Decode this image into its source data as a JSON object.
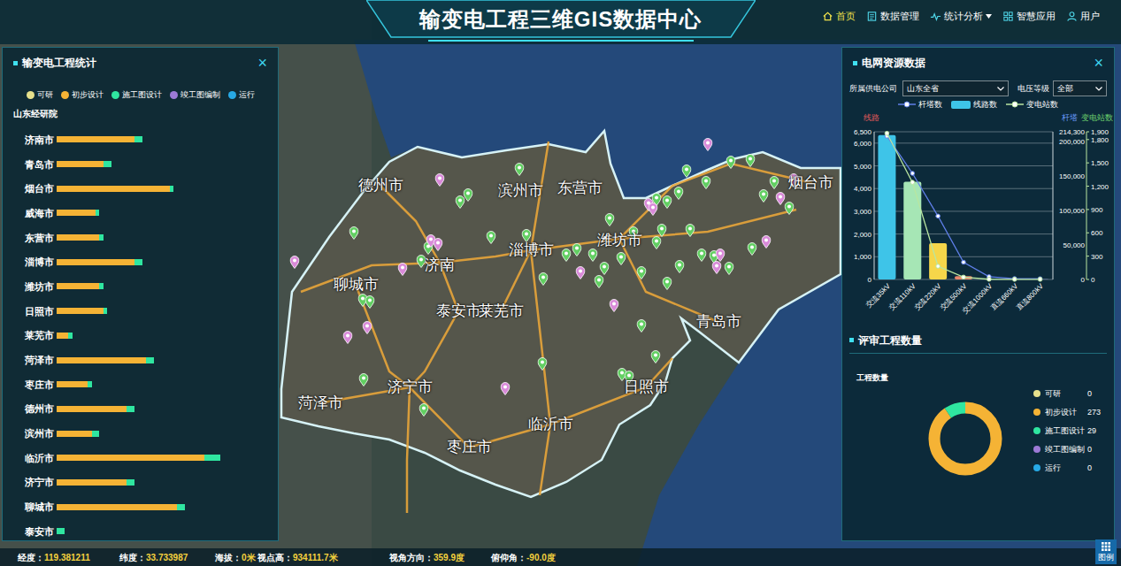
{
  "header": {
    "title": "输变电工程三维GIS数据中心",
    "nav": [
      {
        "label": "首页",
        "kind": "home",
        "selected": true,
        "has_menu": false
      },
      {
        "label": "数据管理",
        "kind": "data",
        "selected": false,
        "has_menu": false
      },
      {
        "label": "统计分析",
        "kind": "stats",
        "selected": false,
        "has_menu": true
      },
      {
        "label": "智慧应用",
        "kind": "apps",
        "selected": false,
        "has_menu": false
      },
      {
        "label": "用户",
        "kind": "user",
        "selected": false,
        "has_menu": false
      }
    ]
  },
  "map": {
    "labels": [
      "德州市",
      "滨州市",
      "东营市",
      "烟台市",
      "淄博市",
      "潍坊市",
      "济南",
      "聊城市",
      "泰安市",
      "莱芜市",
      "青岛市",
      "济宁市",
      "日照市",
      "菏泽市",
      "临沂市",
      "枣庄市"
    ],
    "markers": [
      {
        "color": "#62cf62"
      },
      {
        "color": "#62cf62"
      },
      {
        "color": "#62cf62"
      },
      {
        "color": "#62cf62"
      },
      {
        "color": "#62cf62"
      },
      {
        "color": "#62cf62"
      },
      {
        "color": "#62cf62"
      },
      {
        "color": "#62cf62"
      },
      {
        "color": "#62cf62"
      },
      {
        "color": "#62cf62"
      },
      {
        "color": "#62cf62"
      },
      {
        "color": "#62cf62"
      },
      {
        "color": "#62cf62"
      },
      {
        "color": "#62cf62"
      },
      {
        "color": "#62cf62"
      },
      {
        "color": "#62cf62"
      },
      {
        "color": "#62cf62"
      },
      {
        "color": "#62cf62"
      },
      {
        "color": "#62cf62"
      },
      {
        "color": "#62cf62"
      },
      {
        "color": "#62cf62"
      },
      {
        "color": "#62cf62"
      },
      {
        "color": "#62cf62"
      },
      {
        "color": "#62cf62"
      },
      {
        "color": "#62cf62"
      },
      {
        "color": "#62cf62"
      },
      {
        "color": "#62cf62"
      },
      {
        "color": "#62cf62"
      },
      {
        "color": "#62cf62"
      },
      {
        "color": "#62cf62"
      },
      {
        "color": "#62cf62"
      },
      {
        "color": "#62cf62"
      },
      {
        "color": "#62cf62"
      },
      {
        "color": "#62cf62"
      },
      {
        "color": "#62cf62"
      },
      {
        "color": "#62cf62"
      },
      {
        "color": "#62cf62"
      },
      {
        "color": "#62cf62"
      },
      {
        "color": "#62cf62"
      },
      {
        "color": "#62cf62"
      },
      {
        "color": "#62cf62"
      },
      {
        "color": "#62cf62"
      },
      {
        "color": "#62cf62"
      },
      {
        "color": "#62cf62"
      },
      {
        "color": "#62cf62"
      },
      {
        "color": "#62cf62"
      },
      {
        "color": "#d98ad9"
      },
      {
        "color": "#d98ad9"
      },
      {
        "color": "#d98ad9"
      },
      {
        "color": "#d98ad9"
      },
      {
        "color": "#d98ad9"
      },
      {
        "color": "#d98ad9"
      },
      {
        "color": "#d98ad9"
      },
      {
        "color": "#d98ad9"
      },
      {
        "color": "#d98ad9"
      },
      {
        "color": "#d98ad9"
      },
      {
        "color": "#d98ad9"
      },
      {
        "color": "#d98ad9"
      },
      {
        "color": "#d98ad9"
      },
      {
        "color": "#d98ad9"
      },
      {
        "color": "#d98ad9"
      },
      {
        "color": "#d98ad9"
      },
      {
        "color": "#d98ad9"
      },
      {
        "color": "#d98ad9"
      }
    ]
  },
  "left_panel": {
    "title": "输变电工程统计",
    "close": "×",
    "legend": [
      {
        "label": "可研",
        "color": "#e6e08c"
      },
      {
        "label": "初步设计",
        "color": "#f5b335"
      },
      {
        "label": "施工图设计",
        "color": "#2fe6a0"
      },
      {
        "label": "竣工图编制",
        "color": "#9d7ad6"
      },
      {
        "label": "运行",
        "color": "#27a9e6"
      }
    ],
    "org": "山东经研院",
    "rows": [
      {
        "city": "济南市",
        "values": [
          0,
          20,
          2,
          0,
          0
        ]
      },
      {
        "city": "青岛市",
        "values": [
          0,
          12,
          2,
          0,
          0
        ]
      },
      {
        "city": "烟台市",
        "values": [
          0,
          29,
          1,
          0,
          0
        ]
      },
      {
        "city": "威海市",
        "values": [
          0,
          10,
          1,
          0,
          0
        ]
      },
      {
        "city": "东营市",
        "values": [
          0,
          11,
          1,
          0,
          0
        ]
      },
      {
        "city": "淄博市",
        "values": [
          0,
          20,
          2,
          0,
          0
        ]
      },
      {
        "city": "潍坊市",
        "values": [
          0,
          11,
          1,
          0,
          0
        ]
      },
      {
        "city": "日照市",
        "values": [
          0,
          12,
          1,
          0,
          0
        ]
      },
      {
        "city": "莱芜市",
        "values": [
          0,
          3,
          1,
          0,
          0
        ]
      },
      {
        "city": "菏泽市",
        "values": [
          0,
          23,
          2,
          0,
          0
        ]
      },
      {
        "city": "枣庄市",
        "values": [
          0,
          8,
          1,
          0,
          0
        ]
      },
      {
        "city": "德州市",
        "values": [
          0,
          18,
          2,
          0,
          0
        ]
      },
      {
        "city": "滨州市",
        "values": [
          0,
          9,
          2,
          0,
          0
        ]
      },
      {
        "city": "临沂市",
        "values": [
          0,
          38,
          4,
          0,
          0
        ]
      },
      {
        "city": "济宁市",
        "values": [
          0,
          18,
          2,
          0,
          0
        ]
      },
      {
        "city": "聊城市",
        "values": [
          0,
          31,
          2,
          0,
          0
        ]
      },
      {
        "city": "泰安市",
        "values": [
          0,
          0,
          2,
          0,
          0
        ]
      }
    ]
  },
  "right_panel": {
    "title": "电网资源数据",
    "close": "×",
    "filters": [
      {
        "label": "所属供电公司",
        "value": "山东全省"
      },
      {
        "label": "电压等级",
        "value": "全部"
      }
    ],
    "chart": {
      "legend": [
        {
          "label": "杆塔数",
          "kind": "line",
          "color": "#5f7fe8"
        },
        {
          "label": "线路数",
          "kind": "bar",
          "color": "#3ec4e8"
        },
        {
          "label": "变电站数",
          "kind": "line",
          "color": "#b9e6a0"
        }
      ],
      "axis_titles": {
        "left": "线路",
        "middle": "杆塔",
        "right": "变电站数"
      },
      "left_axis": {
        "max": 6500,
        "ticks": [
          {
            "value": 0,
            "label": "0"
          },
          {
            "value": 1000,
            "label": "1,000"
          },
          {
            "value": 2000,
            "label": "2,000"
          },
          {
            "value": 3000,
            "label": "3,000"
          },
          {
            "value": 4000,
            "label": "4,000"
          },
          {
            "value": 5000,
            "label": "5,000"
          },
          {
            "value": 6000,
            "label": "6,000"
          },
          {
            "value": 6500,
            "label": "6,500"
          }
        ]
      },
      "middle_axis": {
        "max": 214300,
        "ticks": [
          {
            "value": 0,
            "label": "0"
          },
          {
            "value": 50000,
            "label": "50,000"
          },
          {
            "value": 100000,
            "label": "100,000"
          },
          {
            "value": 150000,
            "label": "150,000"
          },
          {
            "value": 200000,
            "label": "200,000"
          },
          {
            "value": 214300,
            "label": "214,300"
          }
        ]
      },
      "right_axis": {
        "max": 1900,
        "ticks": [
          {
            "value": 0,
            "label": "0"
          },
          {
            "value": 300,
            "label": "300"
          },
          {
            "value": 600,
            "label": "600"
          },
          {
            "value": 900,
            "label": "900"
          },
          {
            "value": 1200,
            "label": "1,200"
          },
          {
            "value": 1500,
            "label": "1,500"
          },
          {
            "value": 1800,
            "label": "1,800"
          },
          {
            "value": 1900,
            "label": "1,900"
          }
        ]
      },
      "categories": [
        "交流35kV",
        "交流110kV",
        "交流220kV",
        "交流500kV",
        "交流1000kV",
        "直流660kV",
        "直流800kV"
      ],
      "bar_colors": [
        "#3ec4e8",
        "#a6e6b5",
        "#f6d64a",
        "#e8876b",
        "#2aa8d8",
        "#8fd0f0",
        "#b0b0ff"
      ],
      "lines": [
        6350,
        4300,
        1600,
        150,
        20,
        5,
        5
      ],
      "towers": [
        208000,
        154000,
        92000,
        25000,
        4000,
        1200,
        1000
      ],
      "substations": [
        1880,
        1250,
        170,
        30,
        3,
        2,
        2
      ]
    },
    "review": {
      "title": "评审工程数量",
      "subtitle": "工程数量",
      "items": [
        {
          "label": "可研",
          "value": "0",
          "count": 0,
          "color": "#e6e08c"
        },
        {
          "label": "初步设计",
          "value": "273",
          "count": 273,
          "color": "#f5b335"
        },
        {
          "label": "施工图设计",
          "value": "29",
          "count": 29,
          "color": "#2fe6a0"
        },
        {
          "label": "竣工图编制",
          "value": "0",
          "count": 0,
          "color": "#9d7ad6"
        },
        {
          "label": "运行",
          "value": "0",
          "count": 0,
          "color": "#27a9e6"
        }
      ]
    }
  },
  "status_bar": {
    "items": [
      {
        "label": "经度：",
        "value": "119.381211"
      },
      {
        "label": "纬度：",
        "value": "33.733987"
      },
      {
        "label": "海拔：",
        "value": "0米"
      },
      {
        "label": "视点高：",
        "value": "934111.7米"
      },
      {
        "label": "视角方向：",
        "value": "359.9度"
      },
      {
        "label": "俯仰角：",
        "value": "-90.0度"
      }
    ]
  },
  "legend_button": {
    "label": "图例"
  }
}
